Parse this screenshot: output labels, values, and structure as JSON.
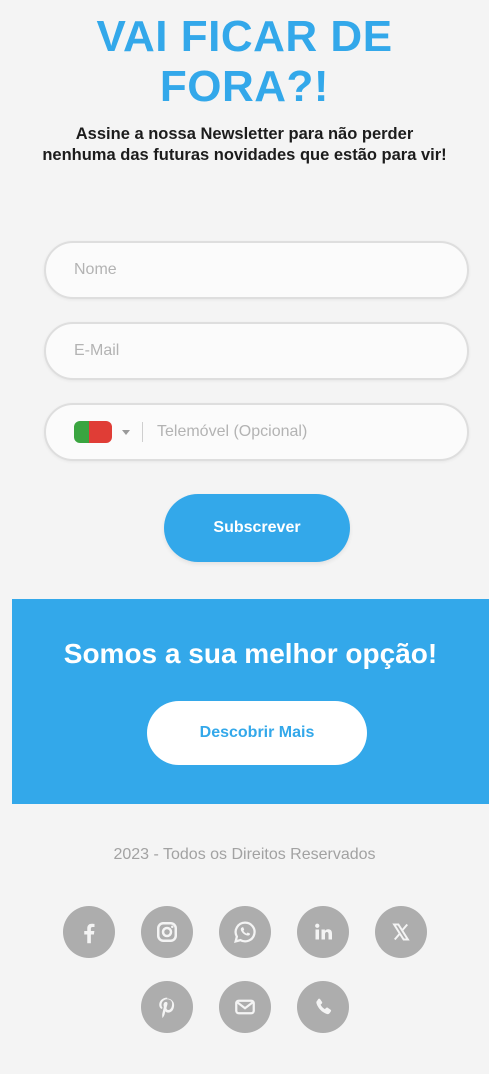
{
  "hero": {
    "title_line1": "VAI FICAR DE",
    "title_line2": "FORA?!",
    "subtitle": "Assine a nossa Newsletter para não perder nenhuma das futuras novidades que estão para vir!"
  },
  "form": {
    "name_placeholder": "Nome",
    "email_placeholder": "E-Mail",
    "phone_placeholder": "Telemóvel (Opcional)",
    "phone_country_flag": "portugal-flag-icon",
    "subscribe_label": "Subscrever"
  },
  "banner": {
    "title": "Somos a sua melhor opção!",
    "button_label": "Descobrir Mais"
  },
  "footer": {
    "copyright": "2023 - Todos os Direitos Reservados",
    "social_icons": [
      "facebook-icon",
      "instagram-icon",
      "whatsapp-icon",
      "linkedin-icon",
      "x-icon",
      "pinterest-icon",
      "email-icon",
      "phone-icon"
    ]
  },
  "colors": {
    "accent": "#33a8ea",
    "background": "#f4f4f4",
    "icon_gray": "#adadad",
    "muted_text": "#a2a2a2"
  }
}
